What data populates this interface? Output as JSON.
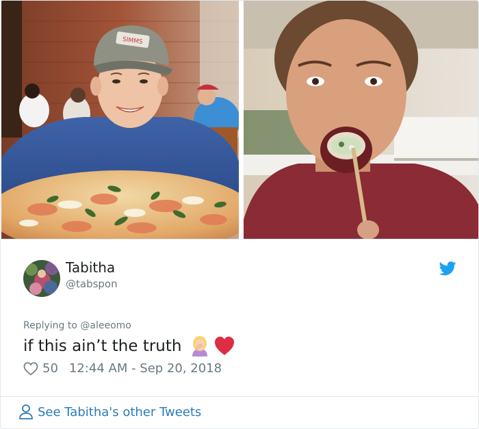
{
  "photos": {
    "left_alt": "young man with pizza",
    "right_alt": "girl eating sushi",
    "cap_text": "SIMMS"
  },
  "user": {
    "display_name": "Tabitha",
    "handle": "@tabspon"
  },
  "tweet": {
    "replying_prefix": "Replying to",
    "replying_mention": "@aleeomo",
    "text": "if this ain’t the truth",
    "emojis": [
      "facepalm-woman-emoji",
      "red-heart-emoji"
    ],
    "like_count": "50",
    "timestamp": "12:44 AM - Sep 20, 2018"
  },
  "footer": {
    "link_text": "See Tabitha's other Tweets"
  },
  "icons": {
    "bird": "twitter-bird-icon",
    "heart": "heart-outline-icon",
    "person": "person-outline-icon"
  },
  "colors": {
    "link_blue": "#2b7bb9",
    "bird_blue": "#1da1f2",
    "muted_gray": "#697882",
    "text": "#1c2022",
    "border": "#e1e8ed",
    "heart_red": "#e0245e"
  }
}
